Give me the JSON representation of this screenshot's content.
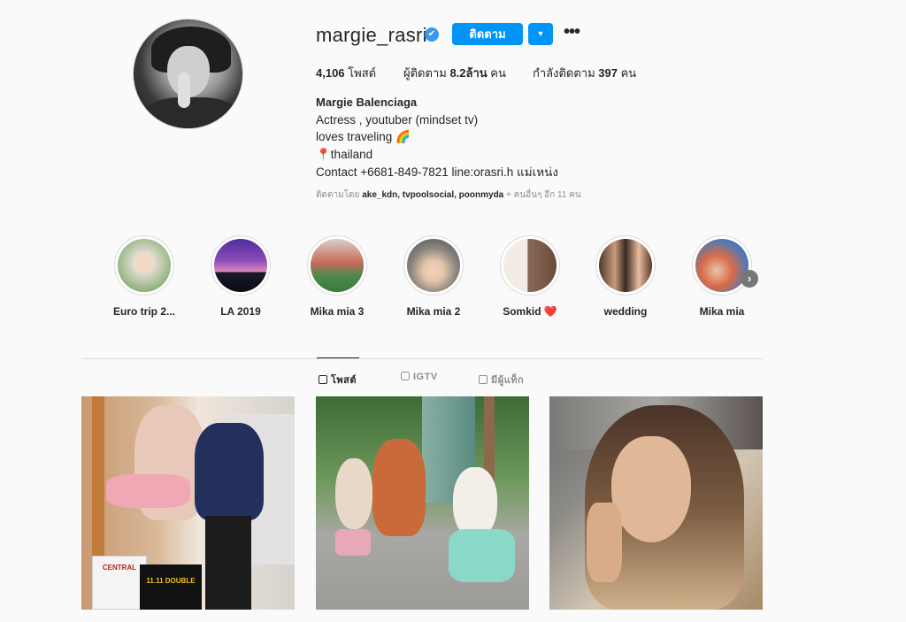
{
  "profile": {
    "username": "margie_rasri",
    "verified_icon": "✔",
    "follow_label": "ติดตาม",
    "dropdown_icon": "▼",
    "more_icon": "•••",
    "stats": {
      "posts_count": "4,106",
      "posts_label": " โพสต์",
      "followers_label": "ผู้ติดตาม ",
      "followers_count": "8.2ล้าน",
      "followers_suffix": " คน",
      "following_label": "กำลังติดตาม ",
      "following_count": "397",
      "following_suffix": " คน"
    },
    "full_name": "Margie Balenciaga",
    "bio_lines": [
      "Actress , youtuber (mindset tv)",
      "loves traveling 🌈",
      "📍thailand",
      "Contact +6681-849-7821 line:orasri.h แม่เหน่ง"
    ],
    "followed_by_prefix": "ติดตามโดย ",
    "followed_by_names": "ake_kdn, tvpoolsocial, poonmyda",
    "followed_by_suffix": " + คนอื่นๆ อีก 11 คน"
  },
  "highlights": [
    {
      "label": "Euro trip 2...",
      "color": "#e9d8c8"
    },
    {
      "label": "LA 2019",
      "color": "#6a4aa8"
    },
    {
      "label": "Mika mia 3",
      "color": "#c86a5a"
    },
    {
      "label": "Mika mia 2",
      "color": "#b8a79a"
    },
    {
      "label": "Somkid ❤️",
      "color": "#d9c7b6"
    },
    {
      "label": "wedding",
      "color": "#8a6048"
    },
    {
      "label": "Mika mia",
      "color": "#d86a4a"
    }
  ],
  "highlight_next_icon": "›",
  "tabs": {
    "posts": "โพสต์",
    "igtv": "IGTV",
    "tagged": "มีผู้แท็ก"
  },
  "posts": [
    {
      "sign_top": "CENTRAL",
      "sign_bottom": "11.11 DOUBLE"
    },
    {},
    {}
  ]
}
